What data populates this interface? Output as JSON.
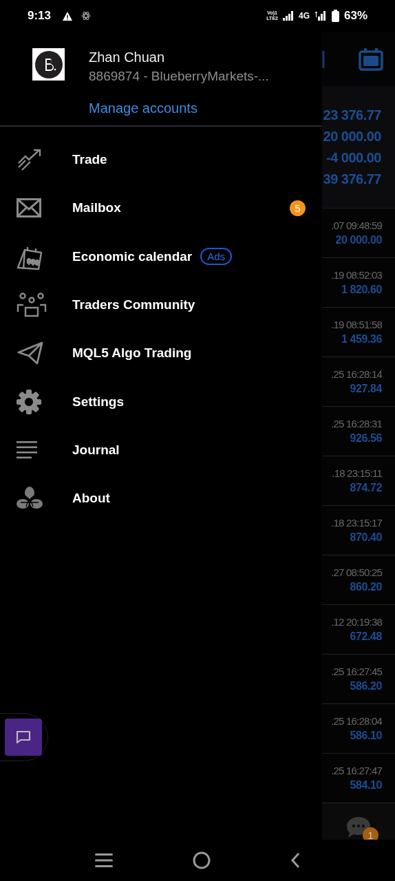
{
  "status_bar": {
    "time": "9:13",
    "network_top": "Vo)1",
    "network_bottom": "LTE2",
    "network_type": "4G",
    "battery": "63%"
  },
  "account": {
    "name": "Zhan Chuan",
    "details": "8869874 - BlueberryMarkets-...",
    "manage_link": "Manage accounts"
  },
  "menu": [
    {
      "label": "Trade"
    },
    {
      "label": "Mailbox",
      "badge": "5"
    },
    {
      "label": "Economic calendar",
      "tag": "Ads"
    },
    {
      "label": "Traders Community"
    },
    {
      "label": "MQL5 Algo Trading"
    },
    {
      "label": "Settings"
    },
    {
      "label": "Journal"
    },
    {
      "label": "About"
    }
  ],
  "background": {
    "summary": [
      "23 376.77",
      "20 000.00",
      "-4 000.00",
      "39 376.77"
    ],
    "rows": [
      {
        "time": ".07 09:48:59",
        "amount": "20 000.00"
      },
      {
        "time": ".19 08:52:03",
        "amount": "1 820.60"
      },
      {
        "time": ".19 08:51:58",
        "amount": "1 459.36"
      },
      {
        "time": ".25 16:28:14",
        "amount": "927.84"
      },
      {
        "time": ".25 16:28:31",
        "amount": "926.56"
      },
      {
        "time": ".18 23:15:11",
        "amount": "874.72"
      },
      {
        "time": ".18 23:15:17",
        "amount": "870.40"
      },
      {
        "time": ".27 08:50:25",
        "amount": "860.20"
      },
      {
        "time": ".12 20:19:38",
        "amount": "672.48"
      },
      {
        "time": ".25 16:27:45",
        "amount": "586.20"
      },
      {
        "time": ".25 16:28:04",
        "amount": "586.10"
      },
      {
        "time": ".25 16:27:47",
        "amount": "584.10"
      }
    ],
    "chat_badge": "1"
  }
}
